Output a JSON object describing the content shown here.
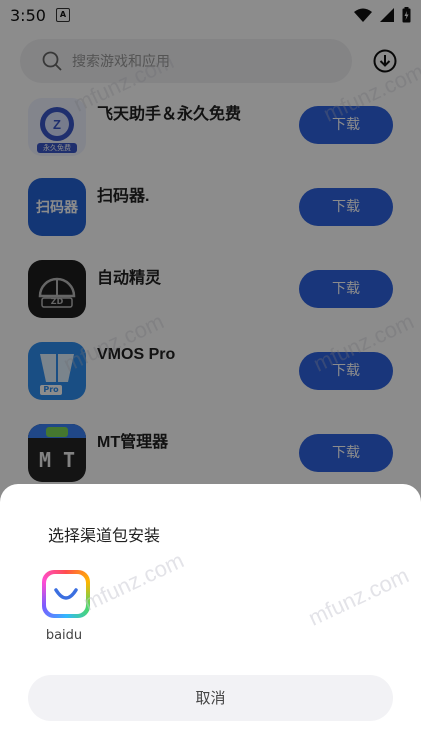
{
  "status_bar": {
    "time": "3:50",
    "sim_label": "A"
  },
  "search": {
    "placeholder": "搜索游戏和应用"
  },
  "apps": [
    {
      "name": "飞天助手＆永久免费",
      "button": "下载",
      "icon": "robot-icon"
    },
    {
      "name": "扫码器.",
      "button": "下载",
      "icon": "scanner-icon"
    },
    {
      "name": "自动精灵",
      "button": "下载",
      "icon": "zd-icon"
    },
    {
      "name": "VMOS Pro",
      "button": "下载",
      "icon": "vmos-icon"
    },
    {
      "name": "MT管理器",
      "button": "下载",
      "icon": "mt-icon"
    }
  ],
  "sheet": {
    "title": "选择渠道包安装",
    "channel": {
      "label": "baidu",
      "icon": "baidu-icon"
    },
    "cancel": "取消"
  },
  "icon_labels": {
    "scanner": "扫码器",
    "zd": "ZD",
    "mt": "M T",
    "vmos_badge": "Pro",
    "robot_badge": "永久免费"
  },
  "watermark": "mfunz.com",
  "colors": {
    "accent": "#2f63e0"
  }
}
